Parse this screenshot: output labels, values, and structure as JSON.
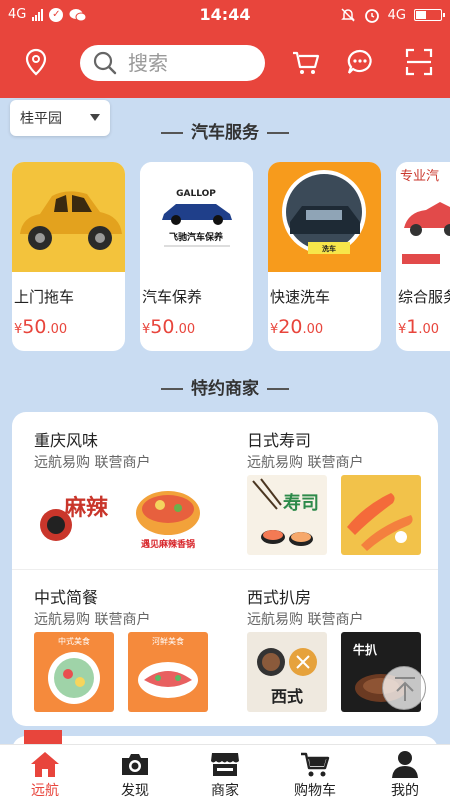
{
  "status_bar": {
    "network_left": "4G",
    "time": "14:44",
    "network_right": "4G"
  },
  "header": {
    "search_placeholder": "搜索",
    "icons": [
      "location-pin-icon",
      "cart-icon",
      "message-icon",
      "scan-icon"
    ]
  },
  "location": {
    "selected": "桂平园"
  },
  "services": {
    "title": "汽车服务",
    "items": [
      {
        "name": "上门拖车",
        "currency": "¥",
        "price_int": "50",
        "price_dec": ".00"
      },
      {
        "name": "汽车保养",
        "currency": "¥",
        "price_int": "50",
        "price_dec": ".00",
        "image_text": "飞驰汽车保养",
        "logo_text": "GALLOP"
      },
      {
        "name": "快速洗车",
        "currency": "¥",
        "price_int": "20",
        "price_dec": ".00",
        "image_text": "洗车"
      },
      {
        "name": "综合服务",
        "currency": "¥",
        "price_int": "1",
        "price_dec": ".00",
        "image_text": "专业汽"
      }
    ]
  },
  "merchants": {
    "title": "特约商家",
    "items": [
      {
        "name": "重庆风味",
        "sub": "远航易购  联营商户",
        "img1_text": "麻辣",
        "img2_text": "遇见麻辣香锅"
      },
      {
        "name": "日式寿司",
        "sub": "远航易购  联营商户",
        "img1_text": "寿司",
        "img2_text": ""
      },
      {
        "name": "中式简餐",
        "sub": "远航易购  联营商户",
        "img1_text": "中式美食",
        "img2_text": "河鲜美食"
      },
      {
        "name": "西式扒房",
        "sub": "远航易购  联营商户",
        "img1_text": "西式",
        "img2_text": "牛扒"
      }
    ]
  },
  "tabbar": {
    "items": [
      {
        "label": "远航",
        "icon": "home-icon",
        "active": true
      },
      {
        "label": "发现",
        "icon": "camera-icon",
        "active": false
      },
      {
        "label": "商家",
        "icon": "store-icon",
        "active": false
      },
      {
        "label": "购物车",
        "icon": "cart-icon",
        "active": false
      },
      {
        "label": "我的",
        "icon": "user-icon",
        "active": false
      }
    ]
  },
  "colors": {
    "primary": "#e8453c",
    "background": "#c9dcf2"
  }
}
